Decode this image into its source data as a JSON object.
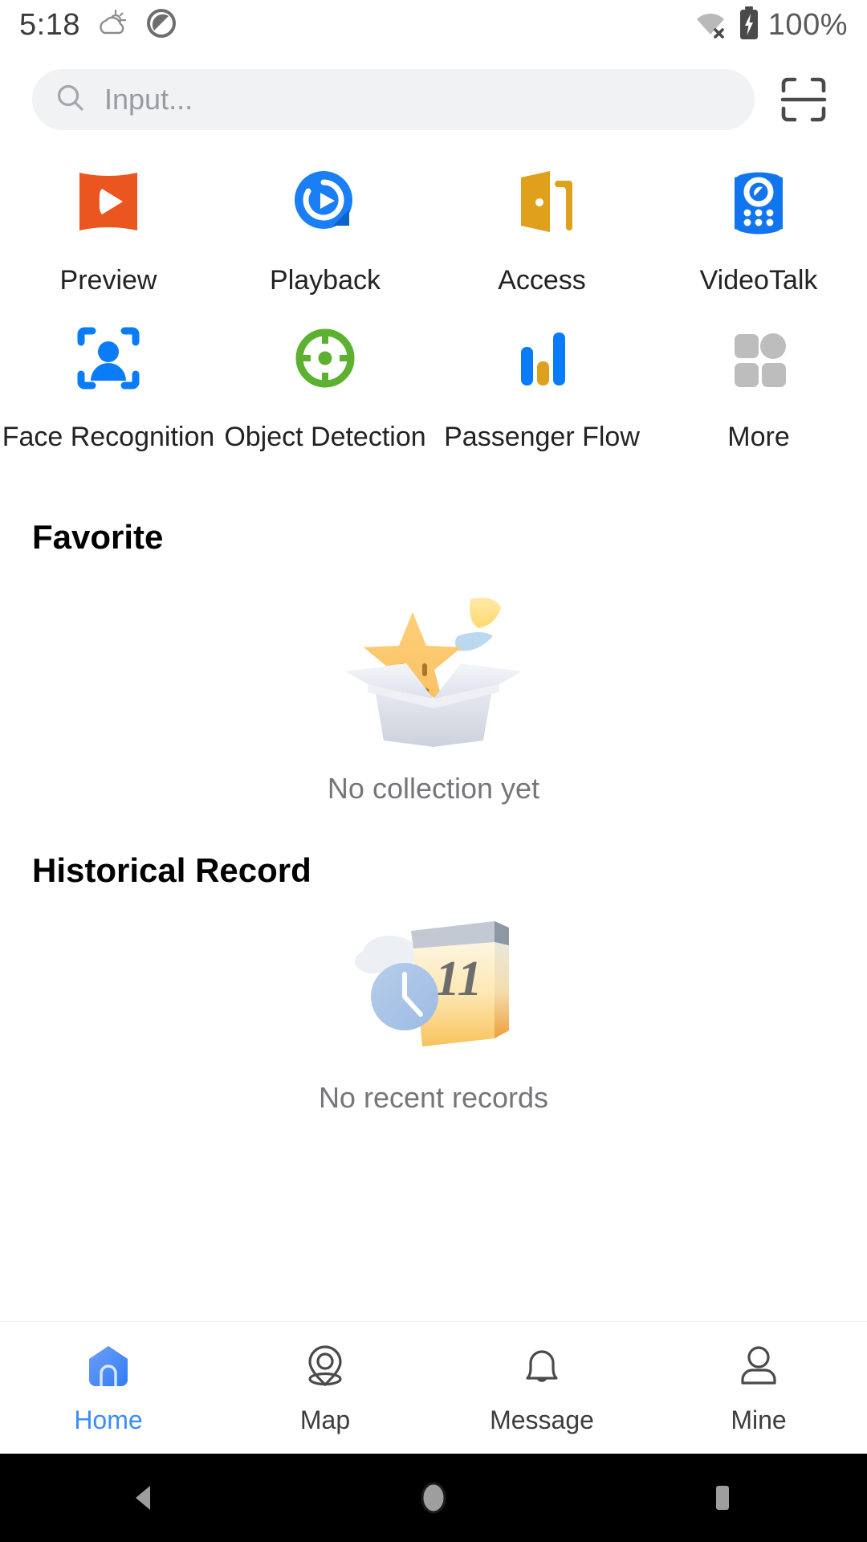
{
  "status_bar": {
    "time": "5:18",
    "battery_percent": "100%",
    "icons": [
      "weather-cloud-sun-icon",
      "do-not-disturb-icon",
      "wifi-disconnected-icon",
      "battery-charging-icon"
    ]
  },
  "search": {
    "placeholder": "Input...",
    "value": "",
    "search_icon": "search-icon",
    "scan_icon": "scan-icon"
  },
  "app_grid": {
    "items": [
      {
        "label": "Preview",
        "icon": "preview-icon",
        "color": "#ea5520"
      },
      {
        "label": "Playback",
        "icon": "playback-icon",
        "color": "#1a7ef5"
      },
      {
        "label": "Access",
        "icon": "access-door-icon",
        "color": "#dfa01c"
      },
      {
        "label": "VideoTalk",
        "icon": "videotalk-icon",
        "color": "#1176ee"
      },
      {
        "label": "Face Recognition",
        "icon": "face-recognition-icon",
        "color": "#0a7cf7"
      },
      {
        "label": "Object Detection",
        "icon": "object-detection-icon",
        "color": "#5cb130"
      },
      {
        "label": "Passenger Flow",
        "icon": "passenger-flow-icon",
        "color": "#0a7cf7"
      },
      {
        "label": "More",
        "icon": "more-grid-icon",
        "color": "#bdbdbd"
      }
    ]
  },
  "favorite": {
    "title": "Favorite",
    "empty_text": "No collection yet",
    "empty_icon": "empty-box-star-icon"
  },
  "historical_record": {
    "title": "Historical Record",
    "empty_text": "No recent records",
    "empty_icon": "calendar-clock-icon",
    "calendar_day": "11"
  },
  "tab_bar": {
    "active": "Home",
    "active_color": "#3d8bfd",
    "items": [
      {
        "label": "Home",
        "icon": "home-icon"
      },
      {
        "label": "Map",
        "icon": "map-pin-icon"
      },
      {
        "label": "Message",
        "icon": "bell-icon"
      },
      {
        "label": "Mine",
        "icon": "person-icon"
      }
    ]
  },
  "android_nav": {
    "items": [
      {
        "name": "back",
        "icon": "back-triangle-icon"
      },
      {
        "name": "home",
        "icon": "home-circle-icon"
      },
      {
        "name": "recents",
        "icon": "recents-square-icon"
      }
    ]
  }
}
